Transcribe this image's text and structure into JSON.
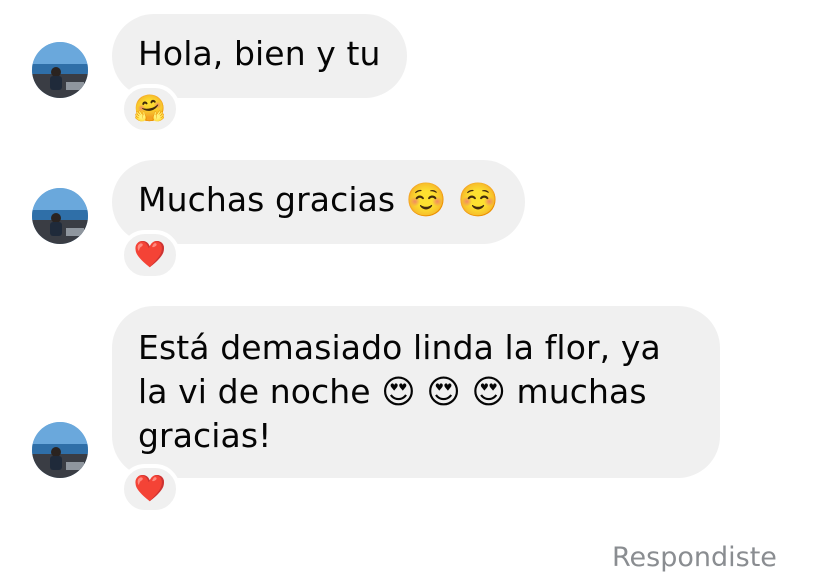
{
  "messages": [
    {
      "text": "Hola, bien y tu",
      "reaction": "🤗",
      "reaction_name": "hugging-face"
    },
    {
      "text": "Muchas gracias ☺️ ☺️",
      "reaction": "❤️",
      "reaction_name": "red-heart"
    },
    {
      "text": "Está demasiado linda la flor, ya la vi de noche 😍 😍 😍  muchas gracias!",
      "reaction": "❤️",
      "reaction_name": "red-heart"
    }
  ],
  "footer": {
    "status": "Respondiste"
  },
  "colors": {
    "bubble": "#f0f0f0",
    "text": "#050505",
    "muted": "#8a8d91"
  }
}
